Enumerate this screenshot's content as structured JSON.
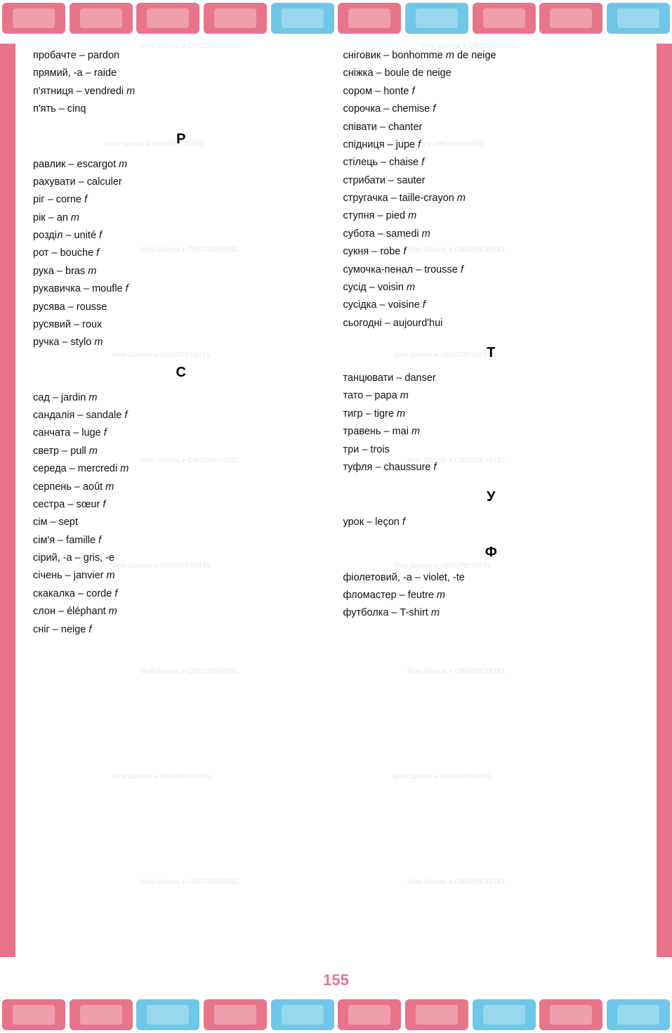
{
  "page": {
    "number": "155"
  },
  "top_strip": {
    "tiles": [
      "pink",
      "blue",
      "pink",
      "pink",
      "blue",
      "pink",
      "blue",
      "pink",
      "pink",
      "blue"
    ]
  },
  "left_column": {
    "intro_entries": [
      "пробачте – pardon",
      "прямий, -а – raide",
      "п'ятниця – vendredi m",
      "п'ять – cinq"
    ],
    "sections": [
      {
        "letter": "Р",
        "entries": [
          "равлик – escargot m",
          "рахувати – calculer",
          "ріг – corne f",
          "рік – an m",
          "розділ – unité f",
          "рот – bouche f",
          "рука – bras m",
          "рукавичка – moufle f",
          "русява – rousse",
          "русявий – roux",
          "ручка – stylo m"
        ]
      },
      {
        "letter": "С",
        "entries": [
          "сад – jardin m",
          "сандалія – sandale f",
          "санчата – luge f",
          "светр – pull m",
          "середа – mercredi m",
          "серпень – août m",
          "сестра – sœur f",
          "сім – sept",
          "сім'я – famille f",
          "сірий, -а – gris, -е",
          "січень – janvier m",
          "скакалка – corde f",
          "слон – éléphant m",
          "сніг – neige f"
        ]
      }
    ]
  },
  "right_column": {
    "intro_entries": [
      "сніговик – bonhomme m de neige",
      "сніжка – boule de neige",
      "сором – honte f",
      "сорочка – chemise f",
      "співати – chanter",
      "спідниця – jupe f",
      "стілець – chaise f",
      "стрибати – sauter",
      "стругачка – taille-crayon m",
      "ступня – pied m",
      "субота – samedi m",
      "сукня – robe f",
      "сумочка-пенал – trousse f",
      "сусід – voisin m",
      "сусідка – voisine f",
      "сьогодні – aujourd'hui"
    ],
    "sections": [
      {
        "letter": "Т",
        "entries": [
          "танцювати – danser",
          "тато – papa m",
          "тигр – tigre m",
          "травень – mai m",
          "три – trois",
          "туфля – chaussure f"
        ]
      },
      {
        "letter": "У",
        "entries": [
          "урок – leçon f"
        ]
      },
      {
        "letter": "Ф",
        "entries": [
          "фіолетовий, -а – violet, -te",
          "фломастер – feutre m",
          "футболка – T-shirt m"
        ]
      }
    ]
  }
}
